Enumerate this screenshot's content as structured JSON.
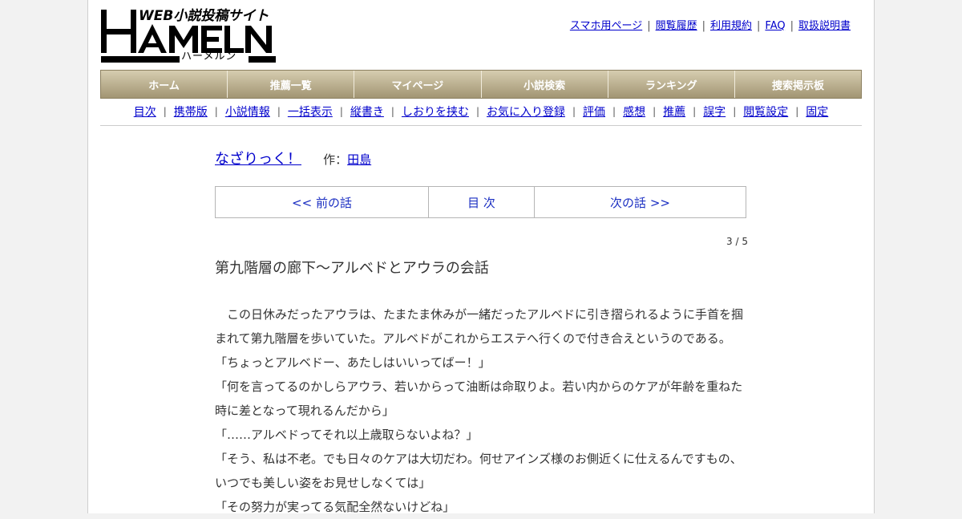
{
  "header": {
    "logo_tagline": "WEB小説投稿サイト",
    "logo_wordmark": "HAMELN",
    "logo_reading": "ハーメルン",
    "top_links": [
      "スマホ用ページ",
      "閲覧履歴",
      "利用規約",
      "FAQ",
      "取扱説明書"
    ]
  },
  "main_nav": [
    "ホーム",
    "推薦一覧",
    "マイページ",
    "小説検索",
    "ランキング",
    "捜索掲示板"
  ],
  "sub_nav": [
    "目次",
    "携帯版",
    "小説情報",
    "一括表示",
    "縦書き",
    "しおりを挟む",
    "お気に入り登録",
    "評価",
    "感想",
    "推薦",
    "誤字",
    "閲覧設定",
    "固定"
  ],
  "separator": "|",
  "novel": {
    "title": "なざりっく！",
    "author_label": "作：",
    "author": "田島"
  },
  "episode_nav": {
    "prev": "<< 前の話",
    "toc": "目 次",
    "next": "次の話 >>"
  },
  "page_count": "3 / 5",
  "chapter_title": "第九階層の廊下～アルベドとアウラの会話",
  "paragraphs": [
    "　この日休みだったアウラは、たまたま休みが一緒だったアルベドに引き摺られるように手首を掴まれて第九階層を歩いていた。アルベドがこれからエステへ行くので付き合えというのである。",
    "「ちょっとアルベドー、あたしはいいってばー！」",
    "「何を言ってるのかしらアウラ、若いからって油断は命取りよ。若い内からのケアが年齢を重ねた時に差となって現れるんだから」",
    "「……アルベドってそれ以上歳取らないよね？」",
    "「そう、私は不老。でも日々のケアは大切だわ。何せアインズ様のお側近くに仕えるんですもの、いつでも美しい姿をお見せしなくては」",
    "「その努力が実ってる気配全然ないけどね」"
  ]
}
